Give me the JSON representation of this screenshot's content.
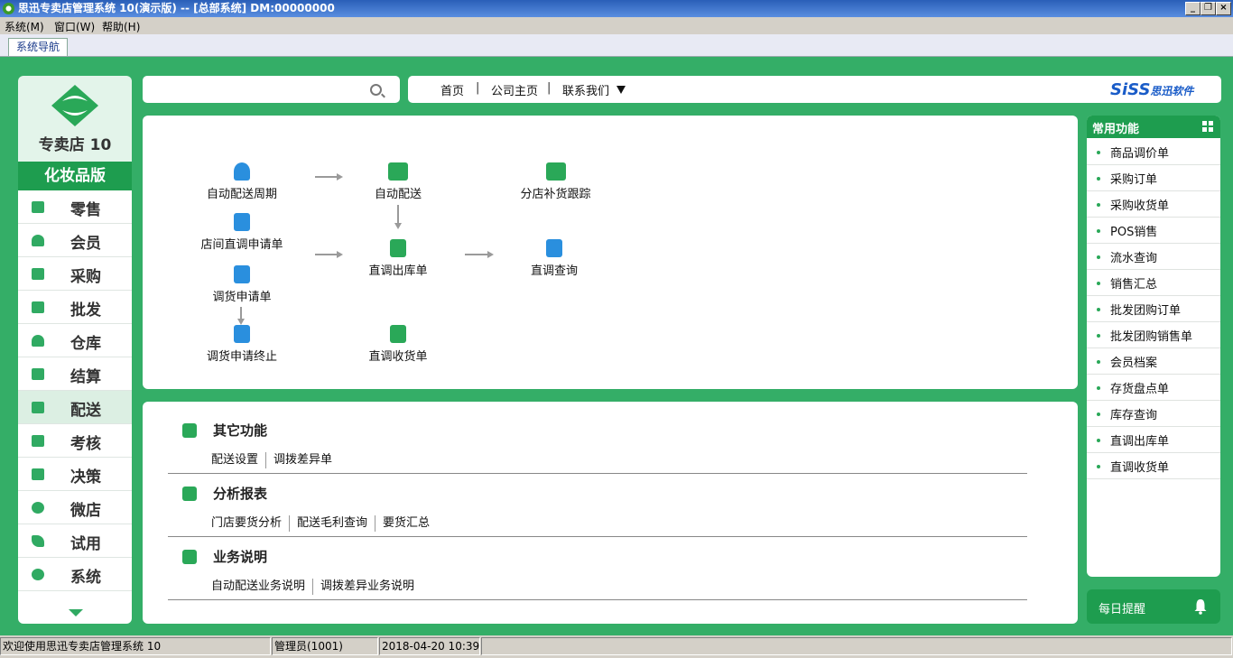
{
  "titlebar": {
    "title": "思迅专卖店管理系统 10(演示版) -- [总部系统] DM:00000000"
  },
  "menubar": {
    "items": [
      "系统(M)",
      "窗口(W)",
      "帮助(H)"
    ]
  },
  "tabs": {
    "active": "系统导航"
  },
  "logo": {
    "product": "专卖店 10"
  },
  "edition": "化妆品版",
  "sidebar": {
    "items": [
      {
        "label": "零售",
        "icon": "bag-icon"
      },
      {
        "label": "会员",
        "icon": "user-icon"
      },
      {
        "label": "采购",
        "icon": "basket-icon"
      },
      {
        "label": "批发",
        "icon": "cart-icon"
      },
      {
        "label": "仓库",
        "icon": "warehouse-icon"
      },
      {
        "label": "结算",
        "icon": "settle-icon"
      },
      {
        "label": "配送",
        "icon": "truck-icon"
      },
      {
        "label": "考核",
        "icon": "clipboard-icon"
      },
      {
        "label": "决策",
        "icon": "thumb-up-icon"
      },
      {
        "label": "微店",
        "icon": "chat-icon"
      },
      {
        "label": "试用",
        "icon": "leaf-icon"
      },
      {
        "label": "系统",
        "icon": "gear-icon"
      }
    ],
    "active": "配送"
  },
  "search": {
    "placeholder": ""
  },
  "topnav": {
    "links": [
      "首页",
      "公司主页",
      "联系我们"
    ],
    "brand_siss": "SiSS",
    "brand_cn": "思迅软件"
  },
  "flow": {
    "nodes": {
      "auto_cycle": "自动配送周期",
      "auto_delivery": "自动配送",
      "branch_track": "分店补货跟踪",
      "store_transfer_request": "店间直调申请单",
      "transfer_out": "直调出库单",
      "transfer_query": "直调查询",
      "transfer_request": "调货申请单",
      "transfer_request_stop": "调货申请终止",
      "transfer_receive": "直调收货单"
    }
  },
  "functions": {
    "sections": [
      {
        "title": "其它功能",
        "links": [
          "配送设置",
          "调拨差异单"
        ]
      },
      {
        "title": "分析报表",
        "links": [
          "门店要货分析",
          "配送毛利查询",
          "要货汇总"
        ]
      },
      {
        "title": "业务说明",
        "links": [
          "自动配送业务说明",
          "调拨差异业务说明"
        ]
      }
    ]
  },
  "quick": {
    "title": "常用功能",
    "items": [
      "商品调价单",
      "采购订单",
      "采购收货单",
      "POS销售",
      "流水查询",
      "销售汇总",
      "批发团购订单",
      "批发团购销售单",
      "会员档案",
      "存货盘点单",
      "库存查询",
      "直调出库单",
      "直调收货单"
    ]
  },
  "reminder": {
    "label": "每日提醒"
  },
  "status": {
    "welcome": "欢迎使用思迅专卖店管理系统 10",
    "user": "管理员(1001)",
    "datetime": "2018-04-20 10:39"
  },
  "colors": {
    "brand_green": "#34ae67",
    "accent_green": "#1e9d4f",
    "icon_blue": "#2a8fde",
    "title_blue": "#2a5fb8"
  }
}
